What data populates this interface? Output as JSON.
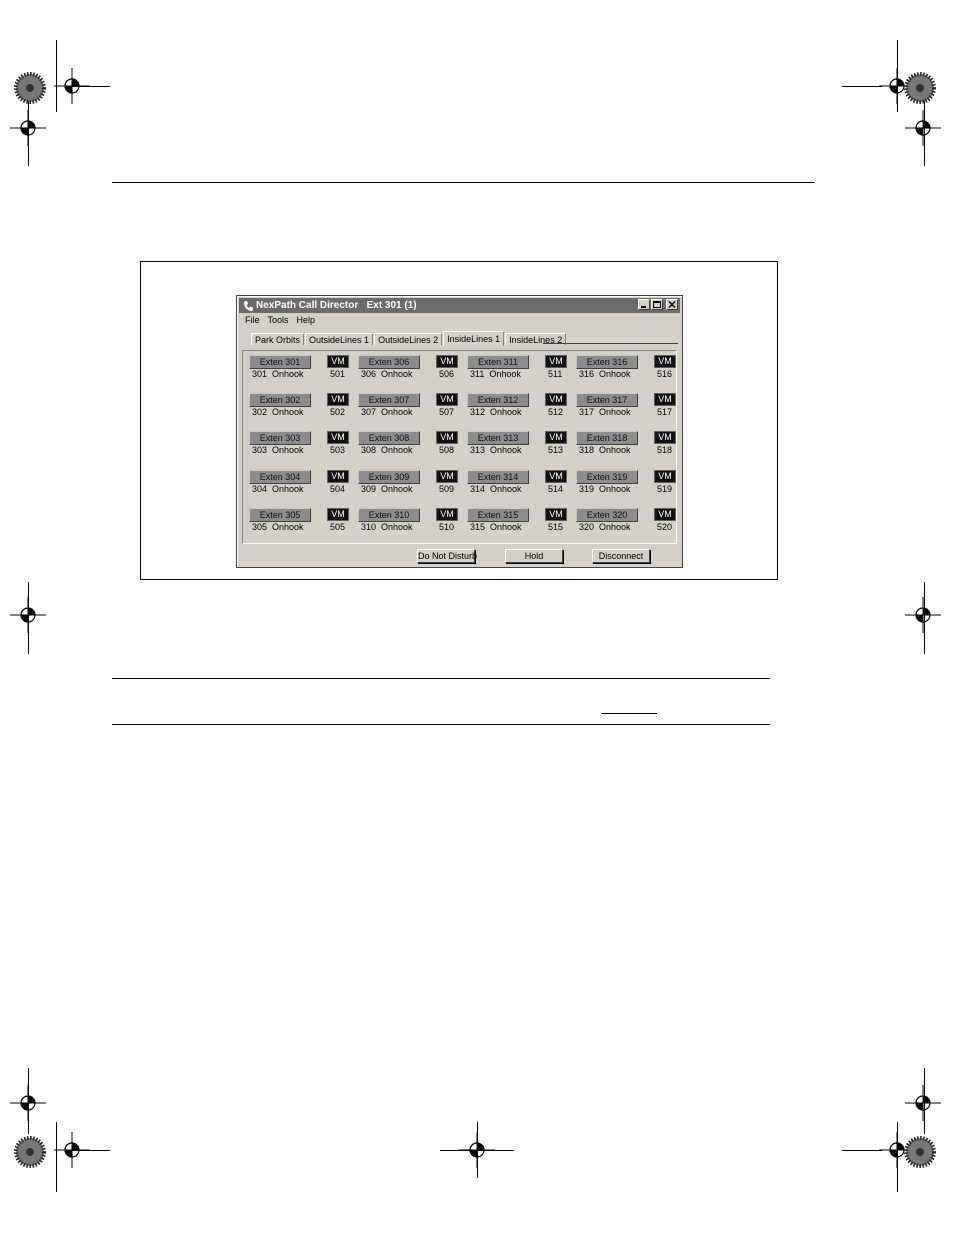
{
  "window": {
    "title": "NexPath Call Director   Ext 301 (1)"
  },
  "menu": [
    "File",
    "Tools",
    "Help"
  ],
  "tabs": [
    {
      "label": "Park Orbits",
      "active": false
    },
    {
      "label": "OutsideLines 1",
      "active": false
    },
    {
      "label": "OutsideLines 2",
      "active": false
    },
    {
      "label": "InsideLines 1",
      "active": true
    },
    {
      "label": "InsideLines 2",
      "active": false
    }
  ],
  "vm_label": "VM",
  "extensions": [
    {
      "label": "Exten 301",
      "status": "301  Onhook",
      "vm": "501"
    },
    {
      "label": "Exten 302",
      "status": "302  Onhook",
      "vm": "502"
    },
    {
      "label": "Exten 303",
      "status": "303  Onhook",
      "vm": "503"
    },
    {
      "label": "Exten 304",
      "status": "304  Onhook",
      "vm": "504"
    },
    {
      "label": "Exten 305",
      "status": "305  Onhook",
      "vm": "505"
    },
    {
      "label": "Exten 306",
      "status": "306  Onhook",
      "vm": "506"
    },
    {
      "label": "Exten 307",
      "status": "307  Onhook",
      "vm": "507"
    },
    {
      "label": "Exten 308",
      "status": "308  Onhook",
      "vm": "508"
    },
    {
      "label": "Exten 309",
      "status": "309  Onhook",
      "vm": "509"
    },
    {
      "label": "Exten 310",
      "status": "310  Onhook",
      "vm": "510"
    },
    {
      "label": "Exten 311",
      "status": "311  Onhook",
      "vm": "511"
    },
    {
      "label": "Exten 312",
      "status": "312  Onhook",
      "vm": "512"
    },
    {
      "label": "Exten 313",
      "status": "313  Onhook",
      "vm": "513"
    },
    {
      "label": "Exten 314",
      "status": "314  Onhook",
      "vm": "514"
    },
    {
      "label": "Exten 315",
      "status": "315  Onhook",
      "vm": "515"
    },
    {
      "label": "Exten 316",
      "status": "316  Onhook",
      "vm": "516"
    },
    {
      "label": "Exten 317",
      "status": "317  Onhook",
      "vm": "517"
    },
    {
      "label": "Exten 318",
      "status": "318  Onhook",
      "vm": "518"
    },
    {
      "label": "Exten 319",
      "status": "319  Onhook",
      "vm": "519"
    },
    {
      "label": "Exten 320",
      "status": "320  Onhook",
      "vm": "520"
    }
  ],
  "actions": {
    "dnd": "Do Not Disturb",
    "hold": "Hold",
    "disconnect": "Disconnect"
  },
  "icons": {
    "app": "phone-icon",
    "minimize": "minimize-icon",
    "maximize": "maximize-icon",
    "close": "close-icon",
    "registration": "crosshair-icon"
  },
  "colors": {
    "titlebar": "#6b6b6b",
    "window": "#d4d0c8",
    "ext_button": "#8c8c8c",
    "vm_button": "#101010"
  }
}
